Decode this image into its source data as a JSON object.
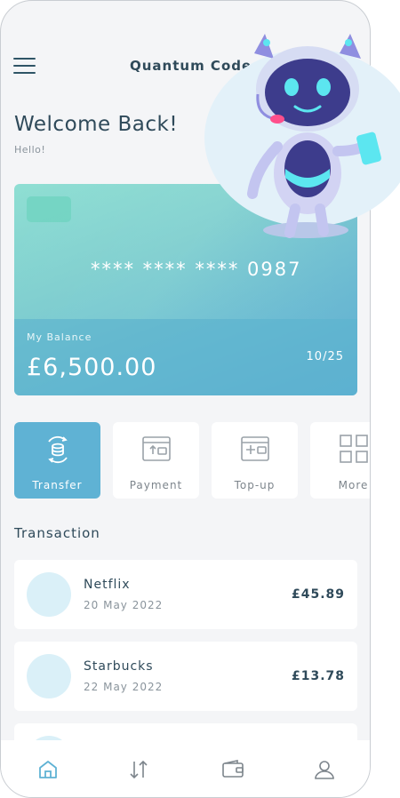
{
  "header": {
    "title": "Quantum Code",
    "menu_icon": "hamburger-menu-icon"
  },
  "welcome": {
    "title": "Welcome Back!",
    "subtitle": "Hello!"
  },
  "card": {
    "number": "**** **** **** 0987",
    "balance_label": "My Balance",
    "balance": "£6,500.00",
    "expiry": "10/25",
    "menu_dots": "•••"
  },
  "actions": [
    {
      "label": "Transfer",
      "icon": "transfer-icon",
      "active": true
    },
    {
      "label": "Payment",
      "icon": "payment-icon",
      "active": false
    },
    {
      "label": "Top-up",
      "icon": "top-up-icon",
      "active": false
    },
    {
      "label": "More",
      "icon": "grid-icon",
      "active": false
    }
  ],
  "transactions": {
    "title": "Transaction",
    "items": [
      {
        "name": "Netflix",
        "date": "20 May 2022",
        "amount": "£45.89"
      },
      {
        "name": "Starbucks",
        "date": "22 May 2022",
        "amount": "£13.78"
      }
    ]
  },
  "bottom_nav": [
    {
      "icon": "home-icon",
      "active": true
    },
    {
      "icon": "transfer-arrows-icon",
      "active": false
    },
    {
      "icon": "wallet-icon",
      "active": false
    },
    {
      "icon": "profile-icon",
      "active": false
    }
  ],
  "colors": {
    "accent": "#5fb2d4",
    "text_dark": "#2f4a5a",
    "text_muted": "#8a949c",
    "avatar_bg": "#daf0f8",
    "background": "#f4f5f7"
  }
}
